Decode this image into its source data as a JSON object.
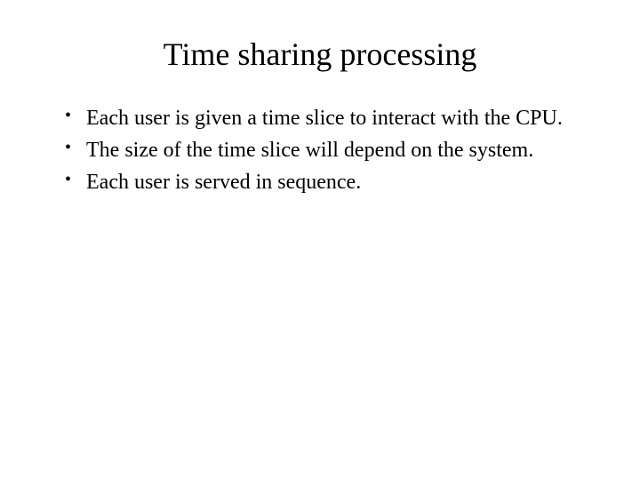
{
  "title": "Time sharing processing",
  "bullets": [
    "Each user is given a time slice to interact with the CPU.",
    "The size of the time slice will depend on the system.",
    "Each user is served in sequence."
  ]
}
